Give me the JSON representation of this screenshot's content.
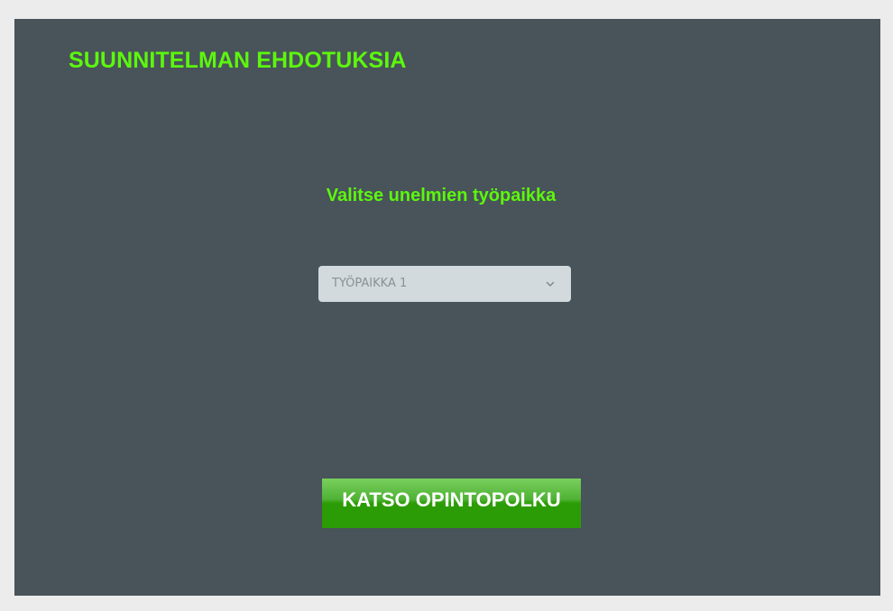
{
  "header": {
    "title": "SUUNNITELMAN EHDOTUKSIA"
  },
  "main": {
    "prompt": "Valitse unelmien työpaikka",
    "job_select": {
      "selected_value": "TYÖPAIKKA 1",
      "icon": "chevron-down-icon"
    },
    "cta_label": "KATSO OPINTOPOLKU"
  },
  "colors": {
    "page_background": "#ececec",
    "panel_background": "#48535a",
    "accent_green": "#5cf70d",
    "button_green": "#2b9c05",
    "select_background": "#d3dadd"
  }
}
